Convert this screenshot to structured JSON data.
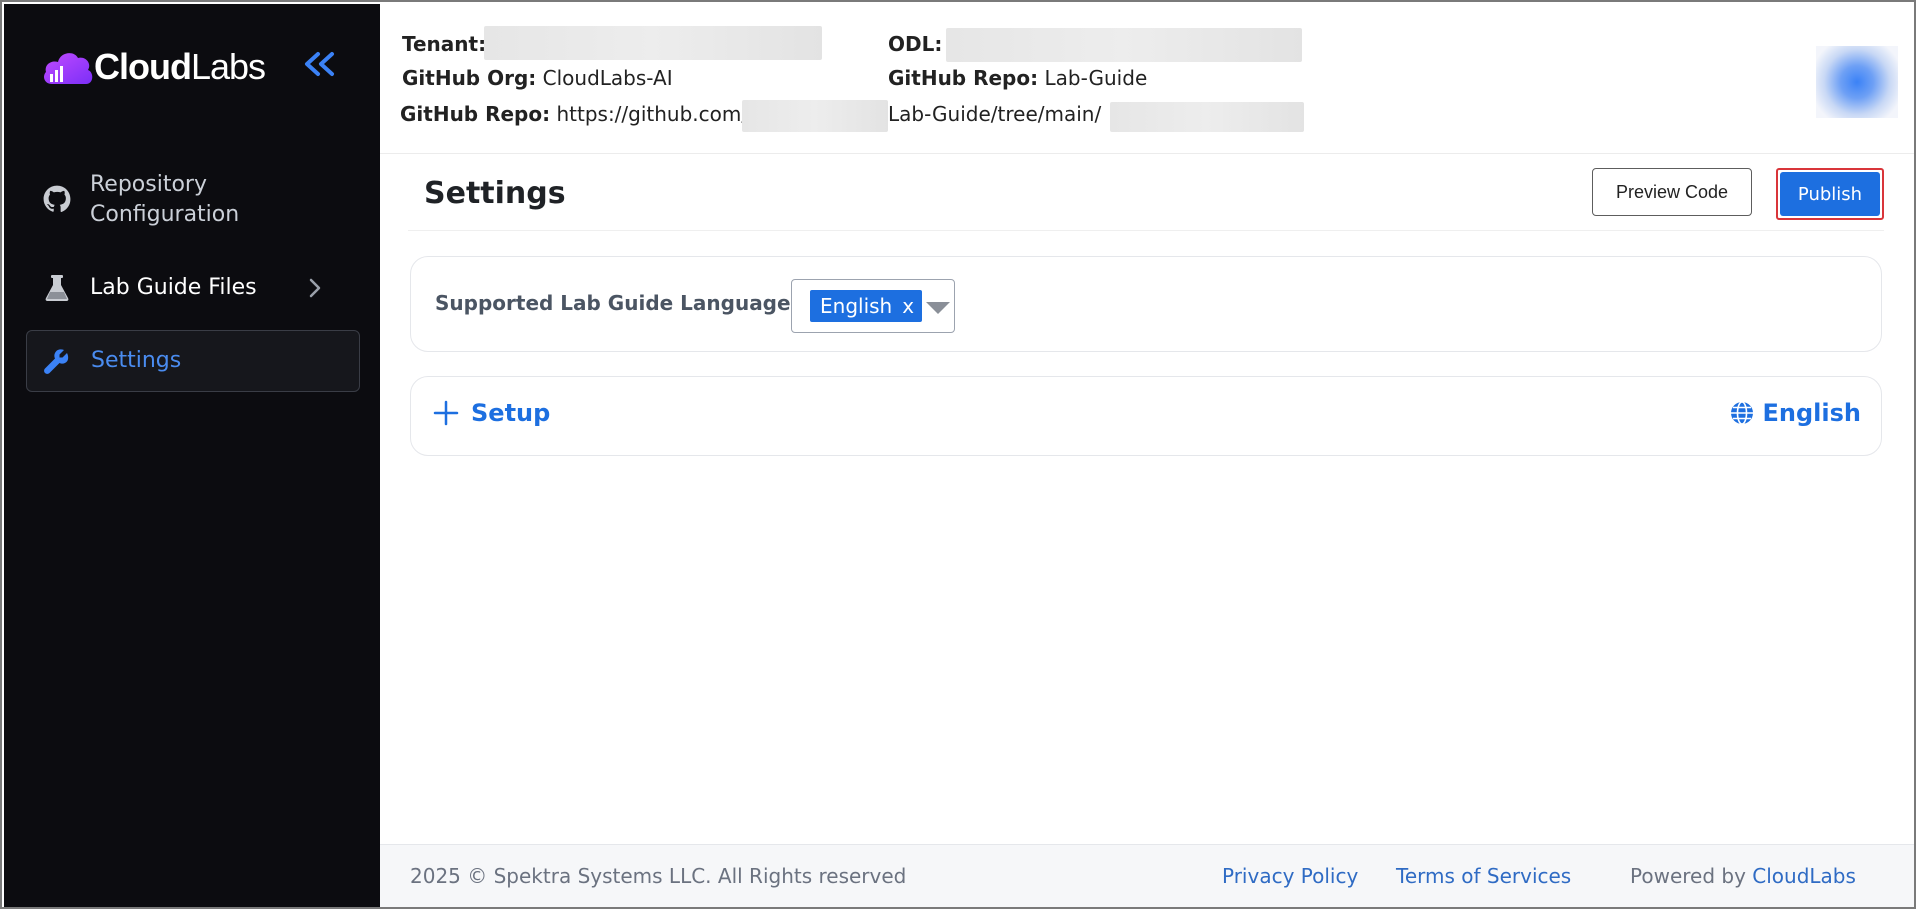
{
  "sidebar": {
    "logo_text": "CloudLabs",
    "items": [
      {
        "label": "Repository Configuration",
        "icon": "github-icon"
      },
      {
        "label": "Lab Guide Files",
        "icon": "flask-icon"
      },
      {
        "label": "Settings",
        "icon": "wrench-icon",
        "active": true
      }
    ]
  },
  "header": {
    "tenant_label": "Tenant:",
    "odl_label": "ODL:",
    "org_label": "GitHub Org:",
    "org_value": "CloudLabs-AI",
    "repo_label": "GitHub Repo:",
    "repo_value": "Lab-Guide",
    "repo_url_label": "GitHub Repo:",
    "repo_url_prefix": "https://github.com/",
    "repo_url_middle": "Lab-Guide/tree/main/"
  },
  "main": {
    "title": "Settings",
    "preview_button": "Preview Code",
    "publish_button": "Publish",
    "languages_label": "Supported Lab Guide Languages",
    "selected_language": "English",
    "chip_remove": "x",
    "setup_label": "Setup",
    "setup_language": "English"
  },
  "footer": {
    "copyright": "2025 © Spektra Systems LLC. All Rights reserved",
    "privacy": "Privacy Policy",
    "terms": "Terms of Services",
    "powered_by": "Powered by",
    "brand": "CloudLabs"
  },
  "colors": {
    "accent": "#1d6fe0",
    "sidebar_bg": "#0c0c10",
    "active_nav": "#4a8cf0",
    "highlight_border": "#d9353a"
  }
}
